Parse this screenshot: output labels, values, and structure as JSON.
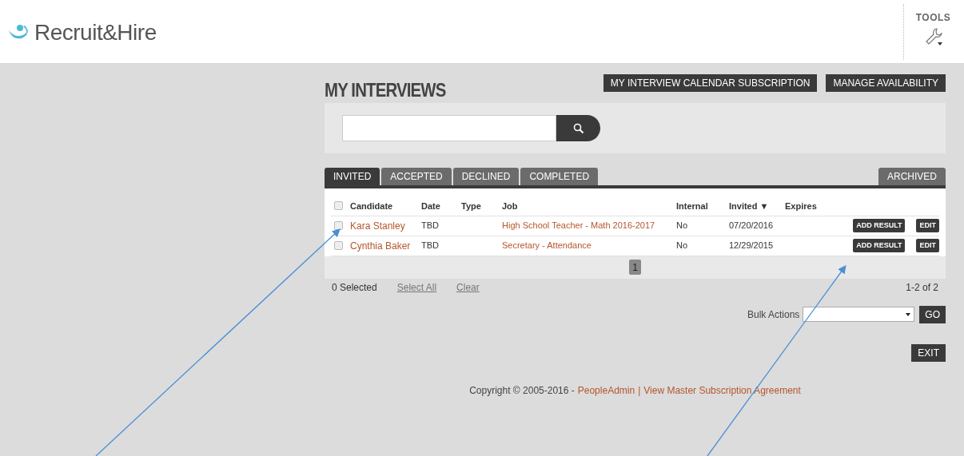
{
  "header": {
    "logo": "Recruit&Hire",
    "tools_label": "TOOLS"
  },
  "page": {
    "title": "MY INTERVIEWS",
    "actions": [
      "MY INTERVIEW CALENDAR SUBSCRIPTION",
      "MANAGE AVAILABILITY"
    ]
  },
  "tabs": [
    {
      "label": "INVITED",
      "selected": true
    },
    {
      "label": "ACCEPTED",
      "selected": false
    },
    {
      "label": "DECLINED",
      "selected": false
    },
    {
      "label": "COMPLETED",
      "selected": false
    }
  ],
  "archived_tab": {
    "label": "ARCHIVED",
    "selected": false
  },
  "table": {
    "all_checked": false,
    "columns": [
      "Candidate",
      "Date",
      "Type",
      "Job",
      "Internal",
      "Invited ▼",
      "Expires"
    ],
    "rows": [
      {
        "candidate": "Kara Stanley",
        "date": "TBD",
        "job": "High School Teacher - Math 2016-2017",
        "internal": "No",
        "invited": "07/20/2016",
        "checked": false,
        "actions": [
          "ADD RESULT",
          "EDIT"
        ]
      },
      {
        "candidate": "Cynthia Baker",
        "date": "TBD",
        "job": "Secretary - Attendance",
        "internal": "No",
        "invited": "12/29/2015",
        "checked": false,
        "actions": [
          "ADD RESULT",
          "EDIT"
        ]
      }
    ]
  },
  "pagination": {
    "pages": [
      {
        "label": "1",
        "selected": true
      }
    ]
  },
  "selection": {
    "count": "0 Selected",
    "select_all": "Select All",
    "clear": "Clear",
    "range": "1-2 of 2"
  },
  "bulk_actions": {
    "label": "Bulk Actions",
    "button": "GO"
  },
  "exit_button": "EXIT",
  "footer": {
    "copyright": "Copyright © 2005-2016 -",
    "company": "PeopleAdmin",
    "separator": "|",
    "agreement": "View Master Subscription Agreement"
  },
  "annotations": [
    {
      "kind": "arrow"
    },
    {
      "kind": "arrow"
    }
  ]
}
